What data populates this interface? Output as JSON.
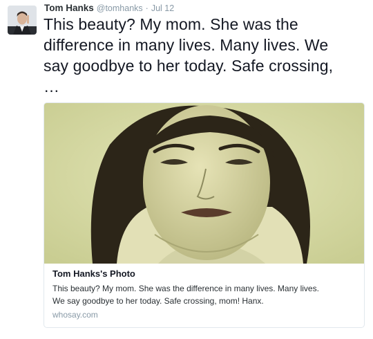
{
  "tweet": {
    "author_name": "Tom Hanks",
    "author_handle": "@tomhanks",
    "separator": "·",
    "time": "Jul 12",
    "text_lines": [
      "This beauty? My mom. She was the",
      "difference in many lives. Many lives. We",
      "say goodbye to her today. Safe crossing,",
      "…"
    ]
  },
  "card": {
    "title": "Tom Hanks's Photo",
    "description_lines": [
      "This beauty? My mom. She was the difference in many lives. Many lives.",
      "We say goodbye to her today. Safe crossing, mom! Hanx."
    ],
    "domain": "whosay.com"
  },
  "icons": {
    "avatar": "profile-avatar-image",
    "photo": "vintage-portrait-photo"
  },
  "colors": {
    "text": "#141823",
    "secondary": "#8899a6",
    "border": "#e1e8ed",
    "photo_tint": "#d9dca8"
  }
}
